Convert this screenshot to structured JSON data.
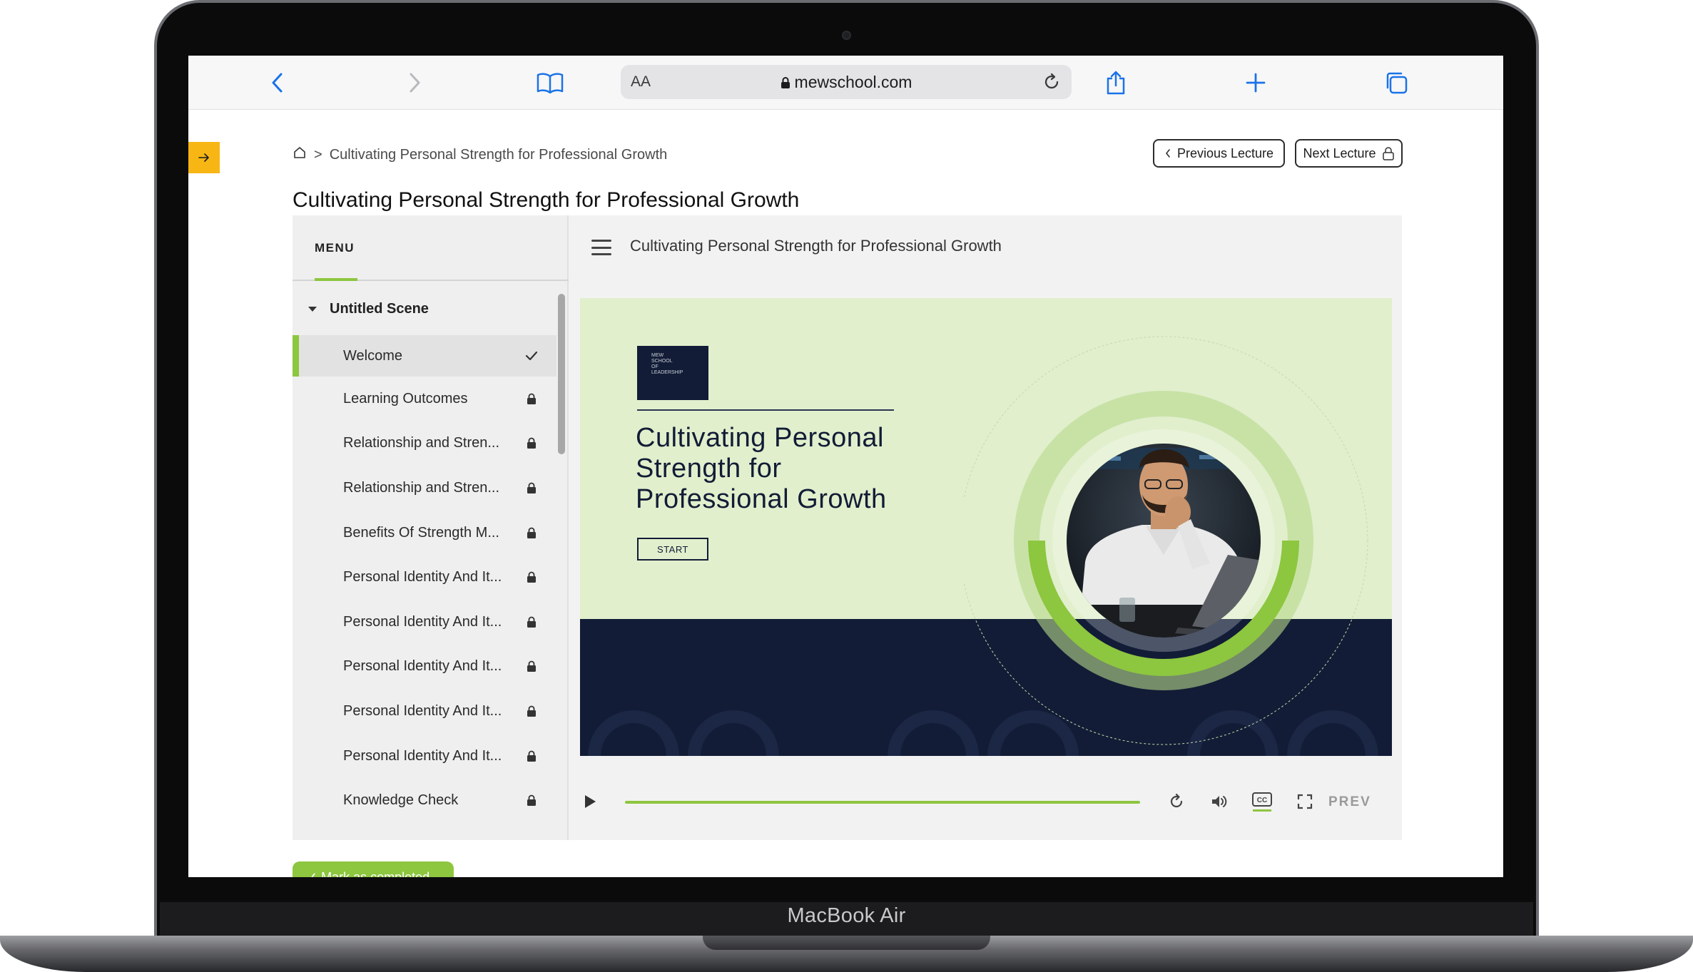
{
  "device": {
    "label": "MacBook Air"
  },
  "browser": {
    "url": "mewschool.com",
    "aa_label": "AA"
  },
  "breadcrumb": {
    "current": "Cultivating Personal Strength for Professional Growth",
    "separator": ">"
  },
  "nav": {
    "previous_label": "Previous Lecture",
    "next_label": "Next Lecture"
  },
  "page": {
    "title": "Cultivating Personal Strength for Professional Growth"
  },
  "menu": {
    "label": "MENU",
    "scene": "Untitled Scene",
    "items": [
      {
        "label": "Welcome",
        "status": "done"
      },
      {
        "label": "Learning Outcomes",
        "status": "locked"
      },
      {
        "label": "Relationship and Stren...",
        "status": "locked"
      },
      {
        "label": "Relationship and Stren...",
        "status": "locked"
      },
      {
        "label": "Benefits Of Strength M...",
        "status": "locked"
      },
      {
        "label": "Personal Identity And It...",
        "status": "locked"
      },
      {
        "label": "Personal Identity And It...",
        "status": "locked"
      },
      {
        "label": "Personal Identity And It...",
        "status": "locked"
      },
      {
        "label": "Personal Identity And It...",
        "status": "locked"
      },
      {
        "label": "Personal Identity And It...",
        "status": "locked"
      },
      {
        "label": "Knowledge Check",
        "status": "locked"
      }
    ]
  },
  "lesson": {
    "title": "Cultivating Personal Strength for Professional Growth"
  },
  "slide": {
    "logo_lines": [
      "MEW",
      "SCHOOL",
      "OF",
      "LEADERSHIP"
    ],
    "title": "Cultivating Personal Strength for Professional Growth",
    "start_label": "START"
  },
  "controls": {
    "prev_label": "PREV",
    "progress": 1.0
  },
  "footer": {
    "mark_completed_label": "✓ Mark as completed"
  },
  "colors": {
    "accent_green": "#8dc63f",
    "navy": "#121c36",
    "toggle_yellow": "#f7b614",
    "safari_blue": "#1a73e8"
  }
}
